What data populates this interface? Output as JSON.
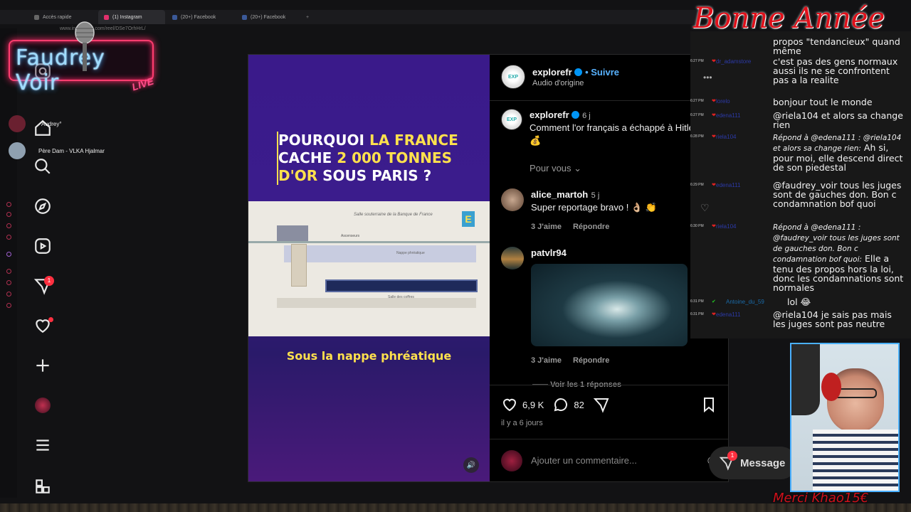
{
  "browser": {
    "tabs": [
      {
        "label": "Accès rapide"
      },
      {
        "label": "(1) Instagram"
      },
      {
        "label": "(20+) Facebook"
      },
      {
        "label": "(20+) Facebook"
      }
    ],
    "address": "www.instagram.com/reel/DSe7OrhHrL/"
  },
  "overlay": {
    "logo_title": "Faudrey Voir",
    "logo_live": "LIVE",
    "viewers": [
      {
        "name": "Audrey°"
      },
      {
        "name": "Père Dam - VLKA Hjalmar"
      }
    ],
    "bonne_annee": "Bonne Année",
    "merci": "Merci Khao15€"
  },
  "sidebar": {
    "notifications_badge": "1",
    "items": [
      "home-icon",
      "search-icon",
      "explore-icon",
      "reels-icon",
      "messages-icon",
      "notifications-icon",
      "create-icon",
      "profile-icon",
      "menu-icon",
      "apps-icon"
    ]
  },
  "video": {
    "title_l1_a": "POURQUOI ",
    "title_l1_b": "LA FRANCE",
    "title_l2_a": "CACHE ",
    "title_l2_b": "2 000 TONNES",
    "title_l3_a": "D'OR",
    "title_l3_b": " SOUS PARIS ?",
    "diagram_title": "Salle souterraine de la Banque de France",
    "diagram_nappe": "Nappe phréatique",
    "diagram_ascenseurs": "Ascenseurs",
    "diagram_salle": "Salle des coffres",
    "subtitle": "Sous la nappe phréatique"
  },
  "post": {
    "author": "explorefr",
    "follow": "• Suivre",
    "audio": "Audio d'origine",
    "caption_age": "6 j",
    "caption": "Comment l'or français a échappé à Hitler ? 💰",
    "see_translation": "Pour vous",
    "comments": [
      {
        "user": "alice_martoh",
        "age": "5 j",
        "text": "Super reportage bravo ! 👌🏼 👏",
        "likes": "3 J'aime",
        "reply": "Répondre"
      },
      {
        "user": "patvlr94",
        "age": "",
        "text": "",
        "likes": "3 J'aime",
        "reply": "Répondre"
      }
    ],
    "more_replies": "Voir les 1 réponses",
    "like_count": "6,9 K",
    "comment_count": "82",
    "date": "il y a 6 jours",
    "add_comment_placeholder": "Ajouter un commentaire...",
    "message_label": "Message",
    "message_badge": "1"
  },
  "chat": [
    {
      "time": "",
      "user": "",
      "text": "propos \"tendancieux\" quand même"
    },
    {
      "time": "6:27 PM",
      "user": "dr_adamstore",
      "text": "c'est pas des gens normaux aussi ils ne se confrontent pas a la realite"
    },
    {
      "time": "6:27 PM",
      "user": "lorelo",
      "text": "bonjour tout le monde"
    },
    {
      "time": "6:27 PM",
      "user": "edena111",
      "text": "@riela104 et alors sa change rien"
    },
    {
      "time": "6:28 PM",
      "user": "riela104",
      "reply": "Répond à @edena111 : @riela104 et alors sa change rien:",
      "text": "Ah si, pour moi, elle descend direct de son piedestal"
    },
    {
      "time": "6:29 PM",
      "user": "edena111",
      "text": "@faudrey_voir tous les juges sont de gauches don. Bon c condamnation bof quoi"
    },
    {
      "time": "6:30 PM",
      "user": "riela104",
      "reply": "Répond à @edena111 : @faudrey_voir tous les juges sont de gauches don. Bon c condamnation bof quoi:",
      "text": "Elle a tenu des propos hors la loi, donc les condamnations sont normales"
    },
    {
      "time": "6:31 PM",
      "user": "Antoine_du_59",
      "text": "lol 😂"
    },
    {
      "time": "6:31 PM",
      "user": "edena111",
      "text": "@riela104 je sais pas mais les juges sont pas neutre"
    }
  ],
  "colors": {
    "accent_blue": "#0095f6",
    "video_purple": "#3a1a8a",
    "title_yellow": "#ffe14d",
    "neon_pink": "#ff3d6e"
  }
}
